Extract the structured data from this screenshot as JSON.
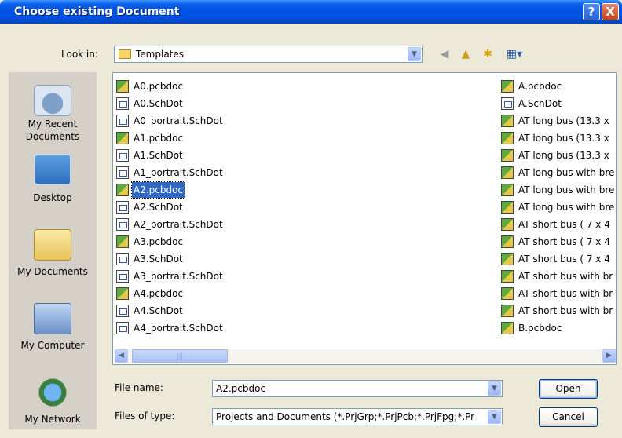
{
  "window": {
    "title": "Choose existing Document",
    "help_glyph": "?",
    "close_glyph": "X"
  },
  "look_in": {
    "label": "Look in:",
    "value": "Templates"
  },
  "toolbar_icons": [
    "back-icon",
    "up-folder-icon",
    "new-folder-icon",
    "view-menu-icon"
  ],
  "places": [
    {
      "label": "My Recent Documents",
      "icon": "recent-documents-icon"
    },
    {
      "label": "Desktop",
      "icon": "desktop-icon"
    },
    {
      "label": "My Documents",
      "icon": "my-documents-icon"
    },
    {
      "label": "My Computer",
      "icon": "my-computer-icon"
    },
    {
      "label": "My Network",
      "icon": "my-network-icon"
    }
  ],
  "files_col1": [
    {
      "name": "A0.pcbdoc",
      "type": "pcb"
    },
    {
      "name": "A0.SchDot",
      "type": "sch"
    },
    {
      "name": "A0_portrait.SchDot",
      "type": "sch"
    },
    {
      "name": "A1.pcbdoc",
      "type": "pcb"
    },
    {
      "name": "A1.SchDot",
      "type": "sch"
    },
    {
      "name": "A1_portrait.SchDot",
      "type": "sch"
    },
    {
      "name": "A2.pcbdoc",
      "type": "pcb",
      "selected": true
    },
    {
      "name": "A2.SchDot",
      "type": "sch"
    },
    {
      "name": "A2_portrait.SchDot",
      "type": "sch"
    },
    {
      "name": "A3.pcbdoc",
      "type": "pcb"
    },
    {
      "name": "A3.SchDot",
      "type": "sch"
    },
    {
      "name": "A3_portrait.SchDot",
      "type": "sch"
    },
    {
      "name": "A4.pcbdoc",
      "type": "pcb"
    },
    {
      "name": "A4.SchDot",
      "type": "sch"
    },
    {
      "name": "A4_portrait.SchDot",
      "type": "sch"
    }
  ],
  "files_col2": [
    {
      "name": "A.pcbdoc",
      "type": "pcb"
    },
    {
      "name": "A.SchDot",
      "type": "sch"
    },
    {
      "name": "AT long bus (13.3 x",
      "type": "pcb"
    },
    {
      "name": "AT long bus (13.3 x",
      "type": "pcb"
    },
    {
      "name": "AT long bus (13.3 x",
      "type": "pcb"
    },
    {
      "name": "AT long bus with bre",
      "type": "pcb"
    },
    {
      "name": "AT long bus with bre",
      "type": "pcb"
    },
    {
      "name": "AT long bus with bre",
      "type": "pcb"
    },
    {
      "name": "AT short bus ( 7 x 4",
      "type": "pcb"
    },
    {
      "name": "AT short bus ( 7 x 4",
      "type": "pcb"
    },
    {
      "name": "AT short bus ( 7 x 4",
      "type": "pcb"
    },
    {
      "name": "AT short bus with br",
      "type": "pcb"
    },
    {
      "name": "AT short bus with br",
      "type": "pcb"
    },
    {
      "name": "AT short bus with br",
      "type": "pcb"
    },
    {
      "name": "B.pcbdoc",
      "type": "pcb"
    }
  ],
  "file_name": {
    "label": "File name:",
    "value": "A2.pcbdoc"
  },
  "file_type": {
    "label": "Files of type:",
    "value": "Projects and Documents (*.PrjGrp;*.PrjPcb;*.PrjFpg;*.Pr"
  },
  "buttons": {
    "open": "Open",
    "cancel": "Cancel"
  },
  "scrollbar": {
    "left_glyph": "◀",
    "right_glyph": "▶",
    "thumb_grip": "|||"
  },
  "colors": {
    "titlebar": "#0054E3",
    "selection": "#316AC5",
    "dialog_bg": "#ECE9D8",
    "places_bg": "#D4D0C8"
  }
}
